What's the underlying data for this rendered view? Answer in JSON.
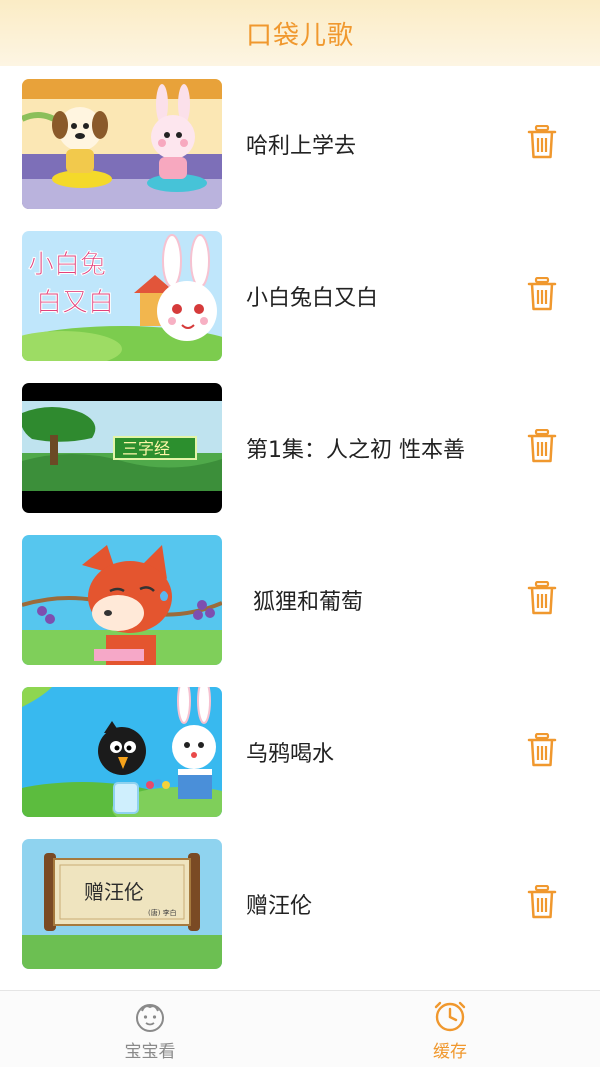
{
  "header": {
    "title": "口袋儿歌"
  },
  "items": [
    {
      "title": "哈利上学去",
      "thumb_text": ""
    },
    {
      "title": "小白兔白又白",
      "thumb_text": "小白兔白又白"
    },
    {
      "title": "第1集：人之初 性本善",
      "thumb_text": "三字经"
    },
    {
      "title": " 狐狸和葡萄",
      "thumb_text": ""
    },
    {
      "title": "乌鸦喝水",
      "thumb_text": ""
    },
    {
      "title": "赠汪伦",
      "thumb_text": "赠汪伦",
      "thumb_subtext": "(唐) 李白"
    }
  ],
  "tabs": [
    {
      "label": "宝宝看",
      "icon": "baby-face-icon",
      "active": false
    },
    {
      "label": "缓存",
      "icon": "clock-icon",
      "active": true
    }
  ],
  "colors": {
    "accent": "#f0982e",
    "header_bg": "#fbecc5",
    "text": "#222222",
    "tab_inactive": "#8a8a8a"
  }
}
